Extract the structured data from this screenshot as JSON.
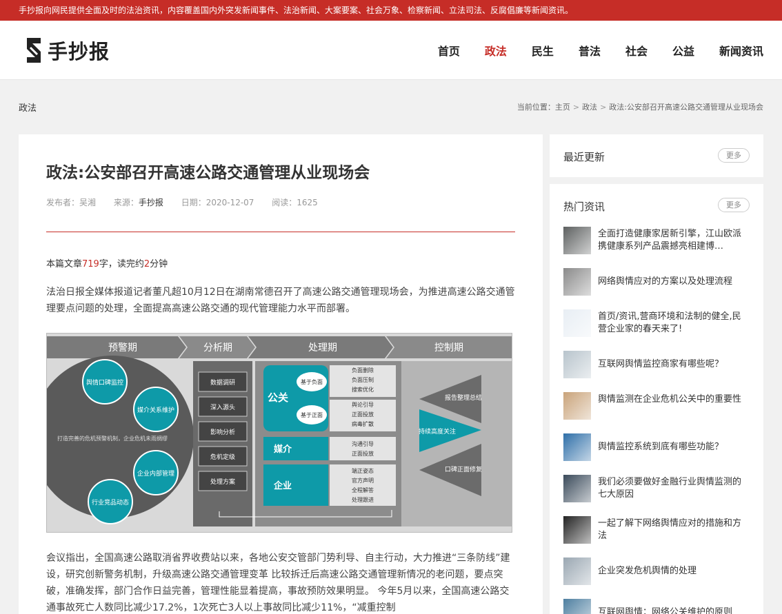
{
  "topbar": {
    "text": "手抄报向网民提供全面及时的法治资讯，内容覆盖国内外突发新闻事件、法治新闻、大案要案、社会万象、检察新闻、立法司法、反腐倡廉等新闻资讯。"
  },
  "header": {
    "logo_text": "手抄报",
    "nav": [
      {
        "label": "首页",
        "active": false
      },
      {
        "label": "政法",
        "active": true
      },
      {
        "label": "民生",
        "active": false
      },
      {
        "label": "普法",
        "active": false
      },
      {
        "label": "社会",
        "active": false
      },
      {
        "label": "公益",
        "active": false
      },
      {
        "label": "新闻资讯",
        "active": false
      }
    ]
  },
  "crumbbar": {
    "section": "政法",
    "prefix": "当前位置：",
    "items": [
      "主页",
      "政法",
      "政法:公安部召开高速公路交通管理从业现场会"
    ]
  },
  "article": {
    "title": "政法:公安部召开高速公路交通管理从业现场会",
    "publisher": "发布者：吴湘",
    "source_label": "来源：",
    "source": "手抄报",
    "date": "日期：2020-12-07",
    "reads": "阅读：1625",
    "read_pre": "本篇文章",
    "word_count": "719",
    "read_mid": "字，读完约",
    "minutes": "2",
    "read_post": "分钟",
    "para1": "法治日报全媒体报道记者董凡超10月12日在湖南常德召开了高速公路交通管理现场会，为推进高速公路交通管理要点问题的处理，全面提高高速公路交通的现代管理能力水平而部署。",
    "para2": "会议指出，全国高速公路取消省界收费站以来，各地公安交管部门势利导、自主行动，大力推进“三条防线”建设，研究创新警务机制，升级高速公路交通管理变革 比较拆迁后高速公路交通管理新情况的老问题，要点突破，准确发挥，部门合作日益完善，管理性能显着提高，事故预防效果明显。 今年5月以来，全国高速公路交通事故死亡人数同比减少17.2%，1次死亡3人以上事故同比减少11%，“减重控制"
  },
  "figure": {
    "phases": [
      "预警期",
      "分析期",
      "处理期",
      "控制期"
    ],
    "warn_circles": [
      "舆情口碑监控",
      "媒介关系维护",
      "企业内部管理",
      "行业竞品动态"
    ],
    "warn_center": "打造完善的危机预警机制，企业危机未雨绸缪",
    "analysis_steps": [
      "数据调研",
      "深入源头",
      "影响分析",
      "危机定级",
      "处理方案"
    ],
    "pr_label": "公关",
    "neg_label": "基于负面",
    "pos_label": "基于正面",
    "neg_items": [
      "负面删除",
      "负面压制",
      "搜索优化"
    ],
    "pos_items": [
      "舆论引导",
      "正面投放",
      "病毒扩散"
    ],
    "media_label": "媒介",
    "media_items": [
      "沟通引导",
      "正面投放"
    ],
    "corp_label": "企业",
    "corp_items": [
      "端正姿态",
      "官方声明",
      "全程解答",
      "处理跟进"
    ],
    "control_items": [
      "报告整理总结",
      "持续高度关注",
      "口碑正面修复"
    ],
    "colors": {
      "teal": "#0e9aa8",
      "dark": "#4a4a4a",
      "arrow": "#6b6b6b"
    }
  },
  "sidebar": {
    "recent_title": "最近更新",
    "hot_title": "热门资讯",
    "more_label": "更多",
    "hot_items": [
      {
        "text": "全面打造健康家居新引擎，江山欧派携健康系列产品震撼亮相建博…",
        "thumb_color": "#5d6060"
      },
      {
        "text": "网络舆情应对的方案以及处理流程",
        "thumb_color": "#8a8a8a"
      },
      {
        "text": "首页/资讯,营商环境和法制的健全,民营企业家的春天来了!",
        "thumb_color": "#e8eef4"
      },
      {
        "text": "互联网舆情监控商家有哪些呢？",
        "thumb_color": "#b8c4cc"
      },
      {
        "text": "舆情监测在企业危机公关中的重要性",
        "thumb_color": "#c9a37a"
      },
      {
        "text": "舆情监控系统到底有哪些功能？",
        "thumb_color": "#2f6fa8"
      },
      {
        "text": "我们必须要做好金融行业舆情监测的七大原因",
        "thumb_color": "#3a4a5a"
      },
      {
        "text": "一起了解下网络舆情应对的措施和方法",
        "thumb_color": "#222222"
      },
      {
        "text": "企业突发危机舆情的处理",
        "thumb_color": "#9aa7b2"
      },
      {
        "text": "互联网舆情：网络公关维护的原则",
        "thumb_color": "#4e7fa0"
      }
    ]
  }
}
